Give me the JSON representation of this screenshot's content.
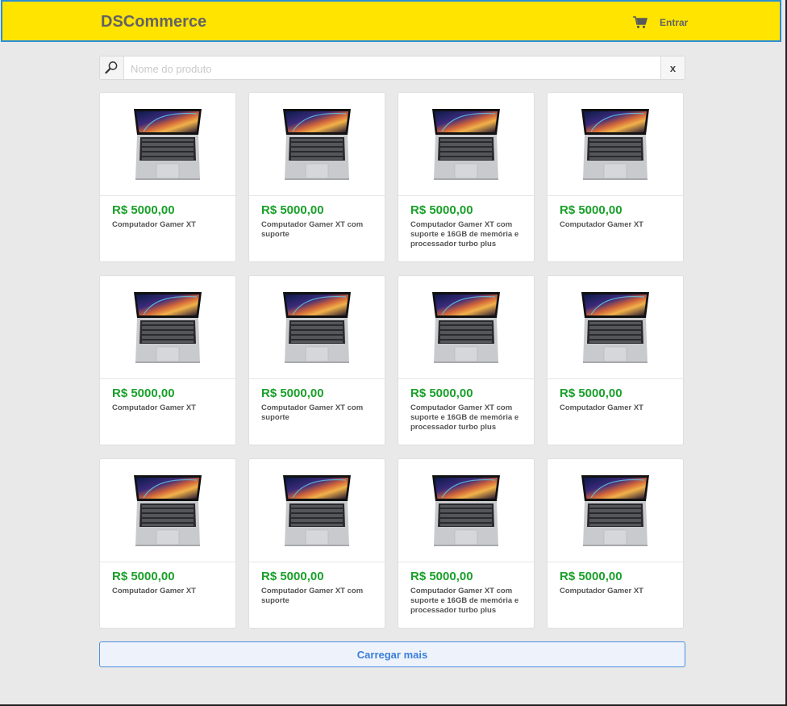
{
  "header": {
    "brand": "DSCommerce",
    "cart_icon": "cart-icon",
    "login_label": "Entrar",
    "background": "#ffe400",
    "border_color": "#2b8fd6"
  },
  "search": {
    "icon": "search-icon",
    "placeholder": "Nome do produto",
    "value": "",
    "clear_label": "x"
  },
  "products": [
    {
      "price": "R$ 5000,00",
      "name": "Computador Gamer XT"
    },
    {
      "price": "R$ 5000,00",
      "name": "Computador Gamer XT com suporte"
    },
    {
      "price": "R$ 5000,00",
      "name": "Computador Gamer XT com suporte e 16GB de memória e processador turbo plus"
    },
    {
      "price": "R$ 5000,00",
      "name": "Computador Gamer XT"
    },
    {
      "price": "R$ 5000,00",
      "name": "Computador Gamer XT"
    },
    {
      "price": "R$ 5000,00",
      "name": "Computador Gamer XT com suporte"
    },
    {
      "price": "R$ 5000,00",
      "name": "Computador Gamer XT com suporte e 16GB de memória e processador turbo plus"
    },
    {
      "price": "R$ 5000,00",
      "name": "Computador Gamer XT"
    },
    {
      "price": "R$ 5000,00",
      "name": "Computador Gamer XT"
    },
    {
      "price": "R$ 5000,00",
      "name": "Computador Gamer XT com suporte"
    },
    {
      "price": "R$ 5000,00",
      "name": "Computador Gamer XT com suporte e 16GB de memória e processador turbo plus"
    },
    {
      "price": "R$ 5000,00",
      "name": "Computador Gamer XT"
    }
  ],
  "load_more_label": "Carregar mais",
  "colors": {
    "price": "#1aa02a",
    "button_accent": "#3a7fdb"
  }
}
